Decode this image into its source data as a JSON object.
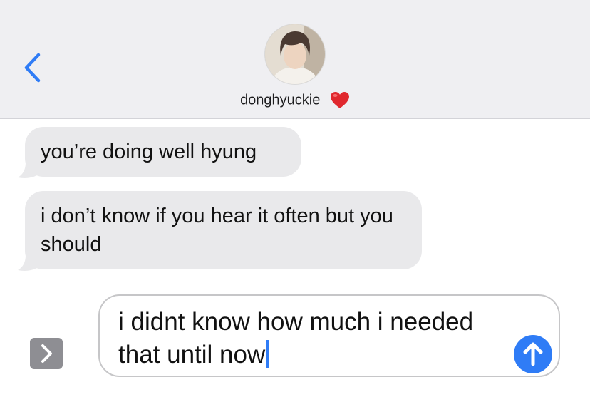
{
  "header": {
    "contact_name": "donghyuckie",
    "heart_emoji": "❤️"
  },
  "messages": [
    {
      "direction": "incoming",
      "text": "you’re doing well hyung"
    },
    {
      "direction": "incoming",
      "text": "i don’t know if you hear it often but you should"
    }
  ],
  "composer": {
    "draft_text": "i didnt know how much i needed that until now"
  },
  "colors": {
    "header_bg": "#efeff2",
    "incoming_bubble": "#e9e9eb",
    "accent_blue": "#2f7cf6",
    "app_button_gray": "#8e8e93"
  },
  "icons": {
    "back": "chevron-left-icon",
    "app_drawer": "chevron-right-icon",
    "send": "arrow-up-icon",
    "favorite": "heart-icon"
  }
}
